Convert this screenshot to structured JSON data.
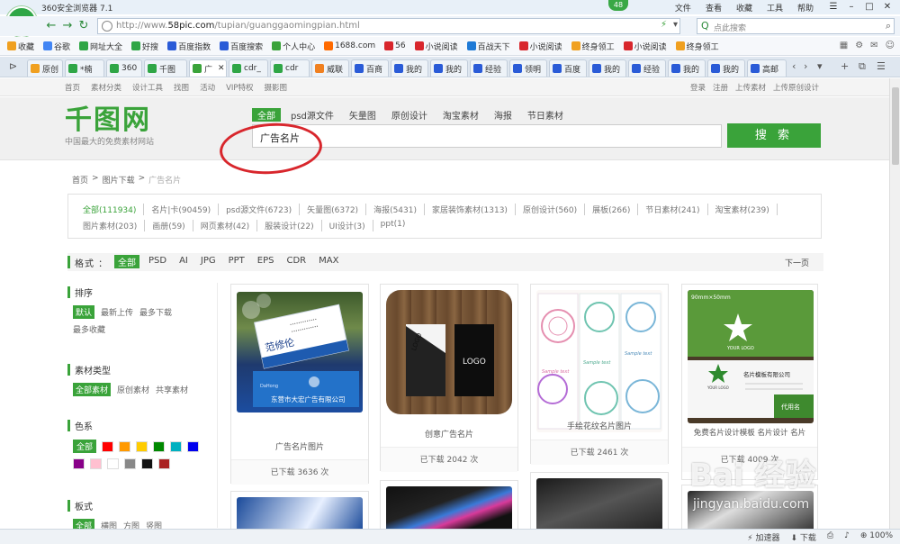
{
  "browser": {
    "title": "360安全浏览器 7.1",
    "tab_count": "48",
    "menu": [
      "文件",
      "查看",
      "收藏",
      "工具",
      "帮助"
    ],
    "logo_letter": "e",
    "url_prefix": "http://www.",
    "url_domain": "58pic.com",
    "url_path": "/tupian/guanggaomingpian.html",
    "search_placeholder": "点此搜索",
    "bookmarks": [
      {
        "label": "收藏",
        "color": "#f0a020"
      },
      {
        "label": "谷歌",
        "color": "#4285f4"
      },
      {
        "label": "网址大全",
        "color": "#2fa646"
      },
      {
        "label": "好搜",
        "color": "#2fa646"
      },
      {
        "label": "百度指数",
        "color": "#2a5bd7"
      },
      {
        "label": "百度搜索",
        "color": "#2a5bd7"
      },
      {
        "label": "个人中心",
        "color": "#3aa33a"
      },
      {
        "label": "1688.com",
        "color": "#ff6a00"
      },
      {
        "label": "56",
        "color": "#d8262c"
      },
      {
        "label": "小说阅读",
        "color": "#d8262c"
      },
      {
        "label": "百战天下",
        "color": "#1e7ad6"
      },
      {
        "label": "小说阅读",
        "color": "#d8262c"
      },
      {
        "label": "终身领工",
        "color": "#f0a020"
      },
      {
        "label": "小说阅读",
        "color": "#d8262c"
      },
      {
        "label": "终身领工",
        "color": "#f0a020"
      }
    ],
    "tabs": [
      {
        "label": "原创",
        "color": "#f0a020"
      },
      {
        "label": "*楠",
        "color": "#2fa646"
      },
      {
        "label": "360",
        "color": "#2fa646"
      },
      {
        "label": "千图",
        "color": "#2fa646"
      },
      {
        "label": "广",
        "color": "#3aa33a"
      },
      {
        "label": "cdr_",
        "color": "#2fa646"
      },
      {
        "label": "cdr",
        "color": "#2fa646"
      },
      {
        "label": "威联",
        "color": "#f08020"
      },
      {
        "label": "百商",
        "color": "#2a5bd7"
      },
      {
        "label": "我的",
        "color": "#2a5bd7"
      },
      {
        "label": "我的",
        "color": "#2a5bd7"
      },
      {
        "label": "经验",
        "color": "#2a5bd7"
      },
      {
        "label": "领明",
        "color": "#2a5bd7"
      },
      {
        "label": "百度",
        "color": "#2a5bd7"
      },
      {
        "label": "我的",
        "color": "#2a5bd7"
      },
      {
        "label": "经验",
        "color": "#2a5bd7"
      },
      {
        "label": "我的",
        "color": "#2a5bd7"
      },
      {
        "label": "我的",
        "color": "#2a5bd7"
      },
      {
        "label": "高邮",
        "color": "#2a5bd7"
      }
    ],
    "zoom": "100%"
  },
  "site": {
    "topnav_left": [
      "首页",
      "素材分类",
      "设计工具",
      "找图",
      "活动",
      "VIP特权",
      "摄影图"
    ],
    "topnav_right": [
      "登录",
      "注册",
      "上传素材",
      "上传原创设计"
    ],
    "logo_text": "千图网",
    "slogan": "中国最大的免费素材网站",
    "search_tabs": [
      "全部",
      "psd源文件",
      "矢量图",
      "原创设计",
      "淘宝素材",
      "海报",
      "节日素材"
    ],
    "search_value": "广告名片",
    "search_button": "搜 索",
    "breadcrumb": [
      "首页",
      ">",
      "图片下载",
      ">",
      "广告名片"
    ],
    "category_rows": [
      [
        "全部(111934)",
        "名片|卡(90459)",
        "psd源文件(6723)",
        "矢量图(6372)",
        "海报(5431)",
        "家居装饰素材(1313)",
        "原创设计(560)",
        "展板(266)",
        "节日素材(241)",
        "淘宝素材(239)"
      ],
      [
        "图片素材(203)",
        "画册(59)",
        "网页素材(42)",
        "服装设计(22)",
        "UI设计(3)",
        "ppt(1)"
      ]
    ],
    "format_label": "格式 ：",
    "formats": [
      "全部",
      "PSD",
      "AI",
      "JPG",
      "PPT",
      "EPS",
      "CDR",
      "MAX"
    ],
    "next_page": "下一页",
    "sidebar": {
      "sort_title": "排序",
      "sort_options": [
        "默认",
        "最新上传",
        "最多下载",
        "最多收藏"
      ],
      "type_title": "素材类型",
      "type_options": [
        "全部素材",
        "原创素材",
        "共享素材"
      ],
      "color_title": "色系",
      "color_all": "全部",
      "colors": [
        "#ff0000",
        "#ff9900",
        "#ffcc00",
        "#008800",
        "#00b0c0",
        "#0000ee",
        "#880088",
        "#ffc0d0",
        "#ffffff",
        "#888888",
        "#111111",
        "#aa2222"
      ],
      "layout_title": "板式",
      "layout_options": [
        "全部",
        "横图",
        "方图",
        "竖图"
      ]
    },
    "cards": [
      {
        "caption": "广告名片图片",
        "downloads": "已下载 3636 次"
      },
      {
        "caption": "创意广告名片",
        "downloads": "已下载 2042 次"
      },
      {
        "caption": "手绘花纹名片图片",
        "downloads": "已下载 2461 次"
      },
      {
        "caption": "免费名片设计模板 名片设计 名片",
        "downloads": "已下载 4009 次"
      }
    ],
    "card_thumb_text": {
      "c1_name": "范修伦",
      "c1_brand": "DaHong",
      "c1_company": "东营市大宏广告有限公司",
      "c2_logo": "LOGO",
      "c3_sample": "Sample text",
      "c4_size": "90mm×50mm",
      "c4_logo": "YOUR LOGO",
      "c4_company": "名片模板有限公司",
      "c4_tag": "代用名"
    }
  },
  "watermark": {
    "main": "Bai 经验",
    "sub": "jingyan.baidu.com"
  },
  "status": {
    "items": [
      "加速器",
      "下载",
      "100%"
    ]
  }
}
